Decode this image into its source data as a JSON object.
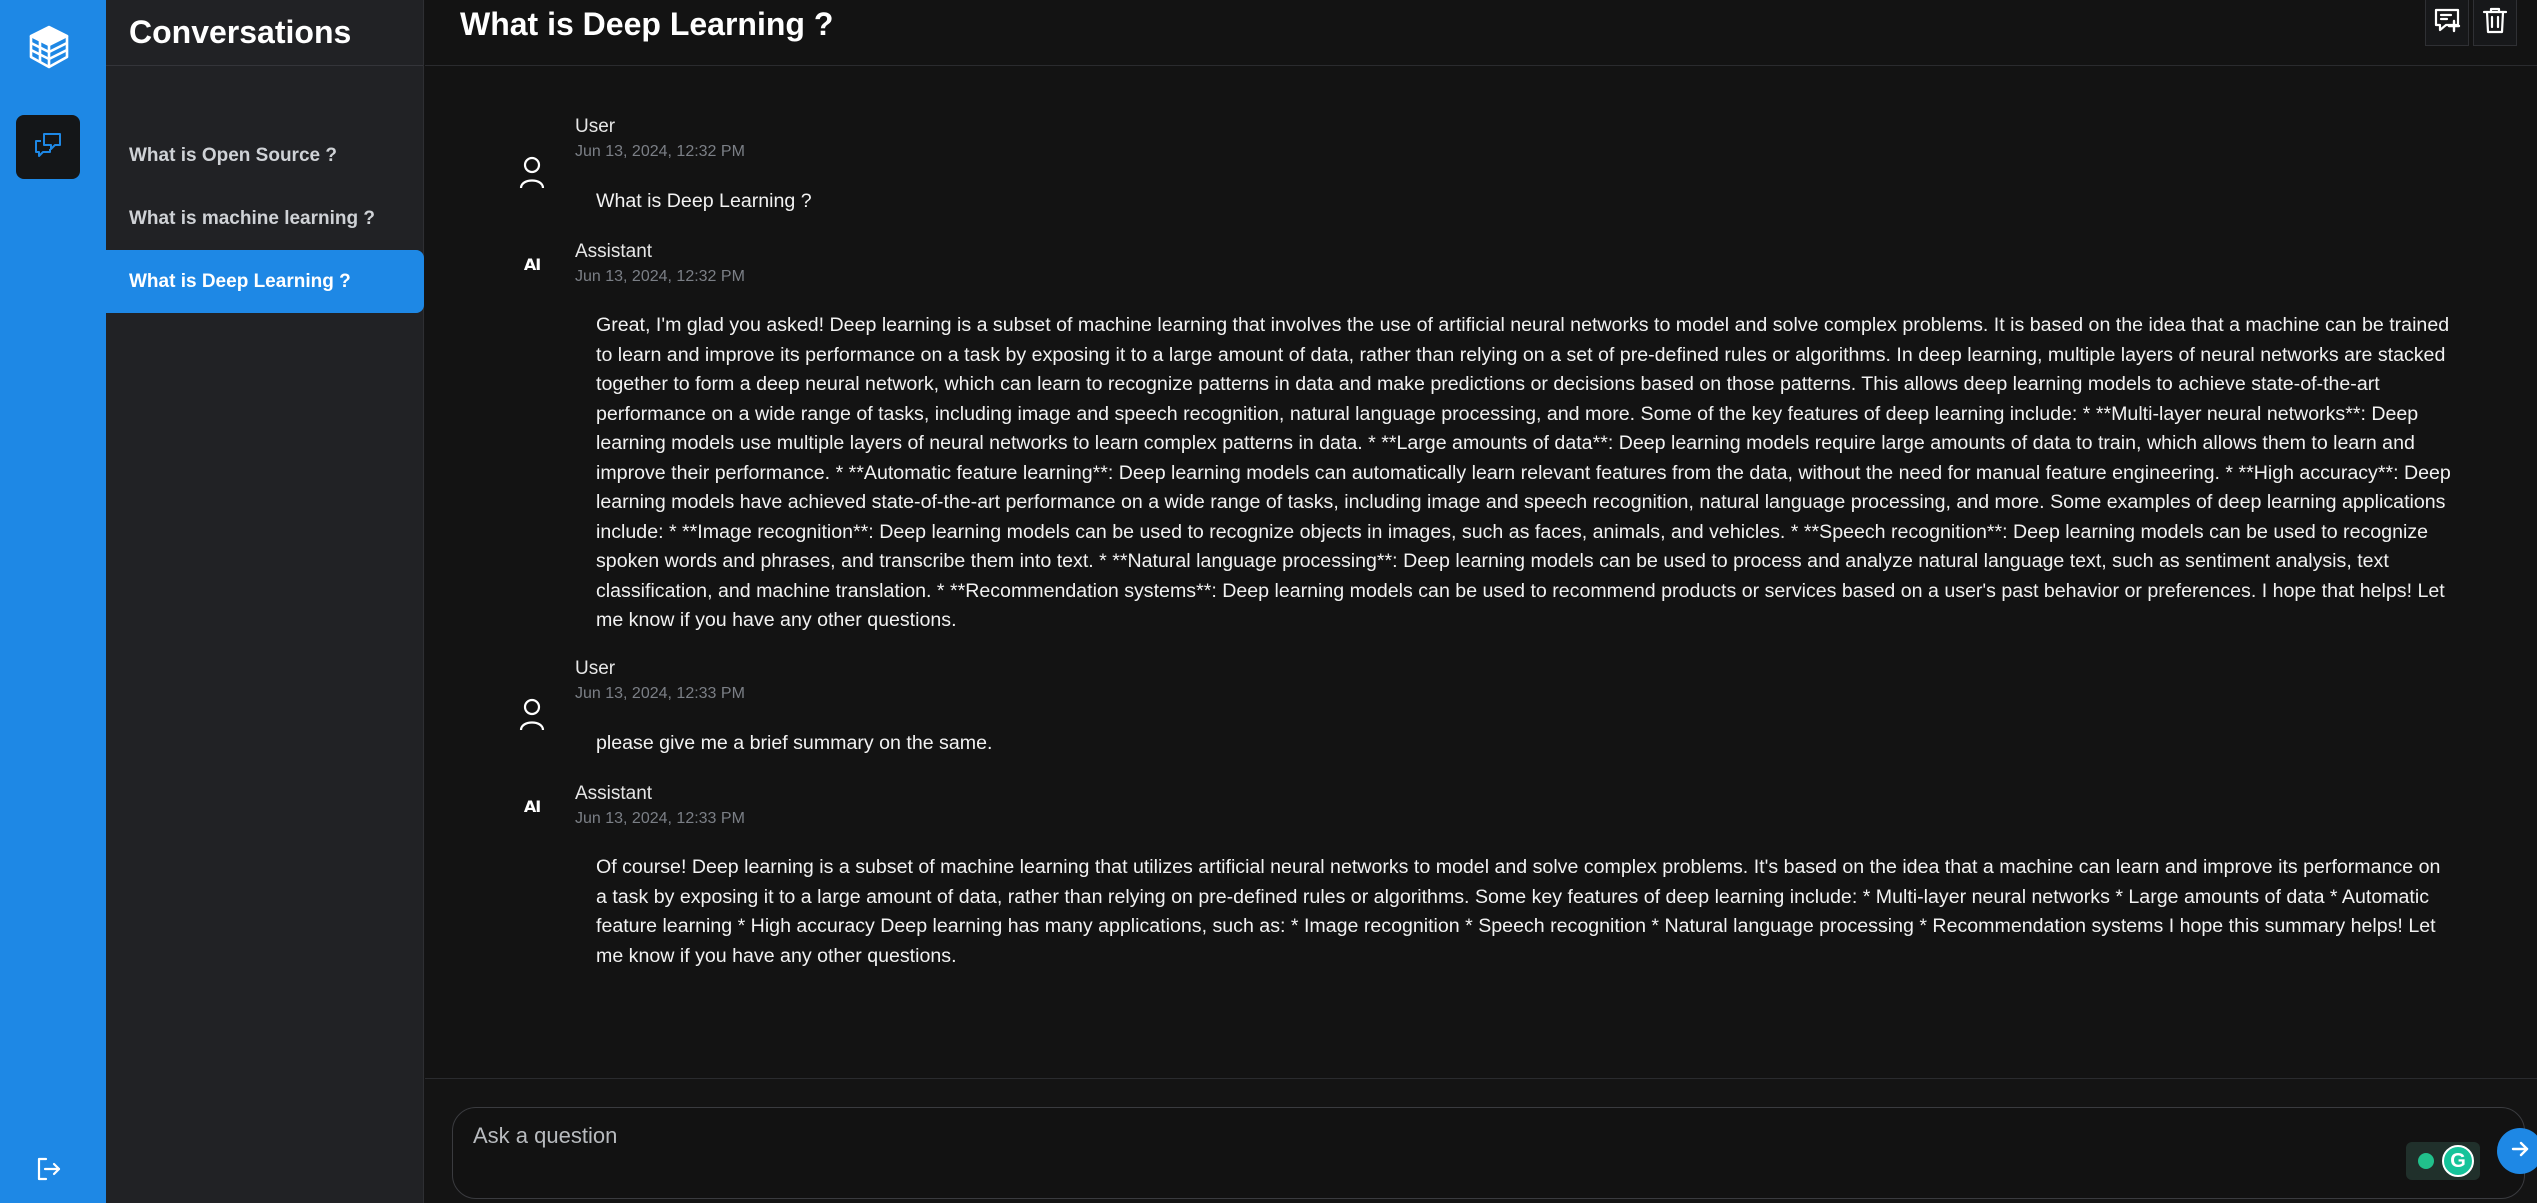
{
  "sidebar": {
    "title": "Conversations",
    "items": [
      {
        "label": "What is Open Source ?"
      },
      {
        "label": "What is machine learning ?"
      },
      {
        "label": "What is Deep Learning ?",
        "active": true
      }
    ]
  },
  "header": {
    "title": "What is Deep Learning ?"
  },
  "messages": [
    {
      "role": "User",
      "time": "Jun 13, 2024, 12:32 PM",
      "text": "What is Deep Learning ?"
    },
    {
      "role": "Assistant",
      "badge": "AI",
      "time": "Jun 13, 2024, 12:32 PM",
      "text": "Great, I'm glad you asked! Deep learning is a subset of machine learning that involves the use of artificial neural networks to model and solve complex problems. It is based on the idea that a machine can be trained to learn and improve its performance on a task by exposing it to a large amount of data, rather than relying on a set of pre-defined rules or algorithms. In deep learning, multiple layers of neural networks are stacked together to form a deep neural network, which can learn to recognize patterns in data and make predictions or decisions based on those patterns. This allows deep learning models to achieve state-of-the-art performance on a wide range of tasks, including image and speech recognition, natural language processing, and more. Some of the key features of deep learning include: * **Multi-layer neural networks**: Deep learning models use multiple layers of neural networks to learn complex patterns in data. * **Large amounts of data**: Deep learning models require large amounts of data to train, which allows them to learn and improve their performance. * **Automatic feature learning**: Deep learning models can automatically learn relevant features from the data, without the need for manual feature engineering. * **High accuracy**: Deep learning models have achieved state-of-the-art performance on a wide range of tasks, including image and speech recognition, natural language processing, and more. Some examples of deep learning applications include: * **Image recognition**: Deep learning models can be used to recognize objects in images, such as faces, animals, and vehicles. * **Speech recognition**: Deep learning models can be used to recognize spoken words and phrases, and transcribe them into text. * **Natural language processing**: Deep learning models can be used to process and analyze natural language text, such as sentiment analysis, text classification, and machine translation. * **Recommendation systems**: Deep learning models can be used to recommend products or services based on a user's past behavior or preferences. I hope that helps! Let me know if you have any other questions."
    },
    {
      "role": "User",
      "time": "Jun 13, 2024, 12:33 PM",
      "text": "please give me a brief summary on the same."
    },
    {
      "role": "Assistant",
      "badge": "AI",
      "time": "Jun 13, 2024, 12:33 PM",
      "text": "Of course! Deep learning is a subset of machine learning that utilizes artificial neural networks to model and solve complex problems. It's based on the idea that a machine can learn and improve its performance on a task by exposing it to a large amount of data, rather than relying on pre-defined rules or algorithms. Some key features of deep learning include: * Multi-layer neural networks * Large amounts of data * Automatic feature learning * High accuracy Deep learning has many applications, such as: * Image recognition * Speech recognition * Natural language processing * Recommendation systems I hope this summary helps! Let me know if you have any other questions."
    }
  ],
  "composer": {
    "placeholder": "Ask a question"
  },
  "icons": {
    "logo": "stacked-cubes-logo",
    "rail_chat": "chat-bubbles-icon",
    "logout": "logout-icon",
    "new_chat": "new-chat-icon",
    "delete": "trash-icon",
    "user_avatar": "user-icon",
    "send": "arrow-right-icon",
    "extension": "grammarly-icon"
  },
  "colors": {
    "accent": "#1e88e5",
    "sidebar_bg": "#212225",
    "main_bg": "#131313"
  }
}
